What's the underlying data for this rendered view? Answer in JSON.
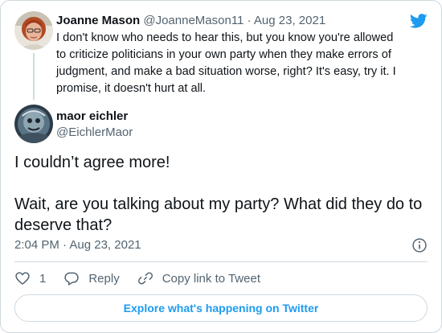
{
  "parent_tweet": {
    "author_name": "Joanne Mason",
    "author_handle": "@JoanneMason11",
    "separator": "·",
    "date": "Aug 23, 2021",
    "text": "I don't know who needs to hear this, but you know you're allowed to criticize politicians in your own party when they make errors of judgment, and make a bad situation worse, right? It's easy, try it. I promise, it doesn't hurt at all."
  },
  "tweet": {
    "author_name": "maor eichler",
    "author_handle": "@EichlerMaor",
    "text_line_1": "I couldn’t agree more!",
    "text_line_2": "Wait, are you talking about my party? What did they do to deserve that?",
    "time": "2:04 PM",
    "separator": "·",
    "date": "Aug 23, 2021"
  },
  "actions": {
    "like_count": "1",
    "reply_label": "Reply",
    "copy_link_label": "Copy link to Tweet"
  },
  "footer": {
    "explore_label": "Explore what's happening on Twitter"
  },
  "icons": {
    "logo": "twitter-bird-icon",
    "info": "info-icon",
    "like": "heart-icon",
    "reply": "reply-bubble-icon",
    "link": "link-icon"
  },
  "colors": {
    "brand_blue": "#1d9bf0",
    "text_primary": "#0f1419",
    "text_secondary": "#536471",
    "border": "#cfd9de"
  }
}
